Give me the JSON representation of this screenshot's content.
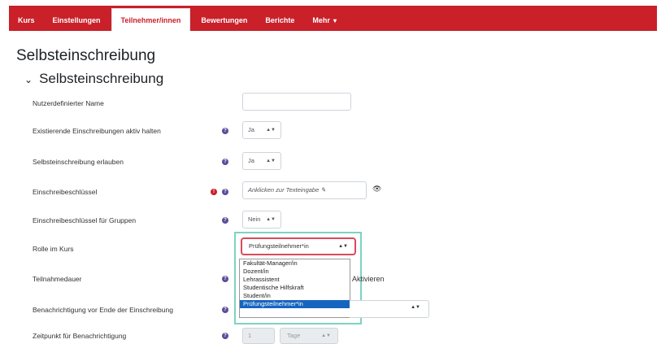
{
  "tabs": [
    {
      "label": "Kurs"
    },
    {
      "label": "Einstellungen"
    },
    {
      "label": "Teilnehmer/innen",
      "active": true
    },
    {
      "label": "Bewertungen"
    },
    {
      "label": "Berichte"
    },
    {
      "label": "Mehr"
    }
  ],
  "page_title": "Selbsteinschreibung",
  "section_title": "Selbsteinschreibung",
  "form": {
    "custom_name_label": "Nutzerdefinierter Name",
    "custom_name_value": "",
    "keep_active_label": "Existierende Einschreibungen aktiv halten",
    "keep_active_value": "Ja",
    "allow_label": "Selbsteinschreibung erlauben",
    "allow_value": "Ja",
    "key_label": "Einschreibeschlüssel",
    "key_value": "Anklicken zur Texteingabe",
    "group_key_label": "Einschreibeschlüssel für Gruppen",
    "group_key_value": "Nein",
    "role_label": "Rolle im Kurs",
    "role_value": "Prüfungsteilnehmer*in",
    "role_options": [
      "Fakultät-Manager/in",
      "Dozent/in",
      "Lehrassistent",
      "Studentische Hilfskraft",
      "Student/in",
      "Prüfungsteilnehmer*in"
    ],
    "duration_label": "Teilnahmedauer",
    "duration_enable": "Aktivieren",
    "notify_label": "Benachrichtigung vor Ende der Einschreibung",
    "notify_time_label": "Zeitpunkt für Benachrichtigung",
    "notify_time_value": "1",
    "notify_time_unit": "Tage"
  },
  "colors": {
    "tabbar": "#c9202a",
    "help": "#5a4e9c",
    "selected_option": "#1565c0"
  }
}
